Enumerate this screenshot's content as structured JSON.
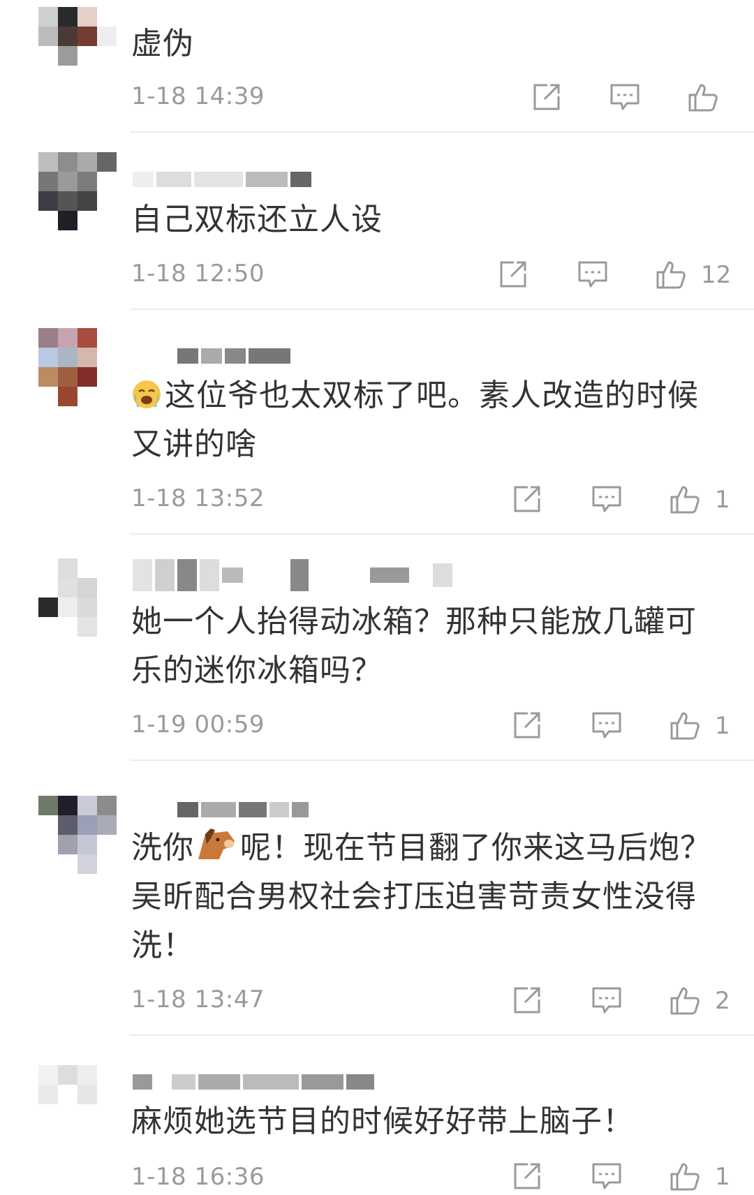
{
  "colors": {
    "text": "#333333",
    "meta": "#9a9a9a",
    "divider": "#ececec",
    "icon": "#9a9a9a"
  },
  "icons": {
    "share": "share-icon",
    "reply": "comment-icon",
    "like": "thumbs-up-icon"
  },
  "comments": [
    {
      "text": "虚伪",
      "time": "1-18 14:39",
      "likes": ""
    },
    {
      "text": "自己双标还立人设",
      "time": "1-18 12:50",
      "likes": "12"
    },
    {
      "emoji": "crying-face-emoji",
      "text": "这位爷也太双标了吧。素人改造的时候又讲的啥",
      "time": "1-18 13:52",
      "likes": "1"
    },
    {
      "text": "她一个人抬得动冰箱？那种只能放几罐可乐的迷你冰箱吗？",
      "time": "1-19 00:59",
      "likes": "1"
    },
    {
      "text_before": "洗你",
      "emoji": "horse-face-emoji",
      "text_after": "呢！现在节目翻了你来这马后炮？吴昕配合男权社会打压迫害苛责女性没得洗！",
      "time": "1-18 13:47",
      "likes": "2"
    },
    {
      "text": "麻烦她选节目的时候好好带上脑子！",
      "time": "1-18 16:36",
      "likes": "1"
    }
  ]
}
